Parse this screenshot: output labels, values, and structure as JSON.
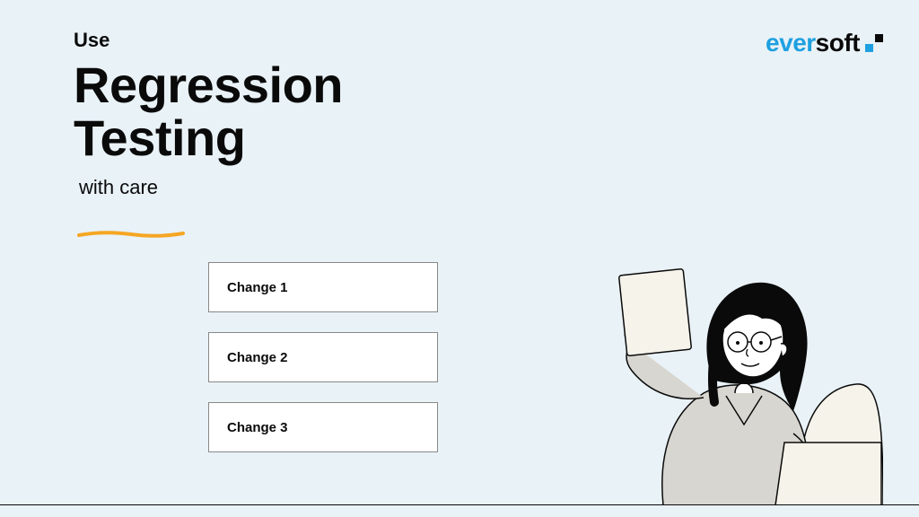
{
  "heading": {
    "pre": "Use",
    "line1": "Regression",
    "line2": "Testing",
    "post": "with care"
  },
  "logo": {
    "part1": "ever",
    "part2": "soft"
  },
  "changes": {
    "items": [
      {
        "label": "Change 1"
      },
      {
        "label": "Change 2"
      },
      {
        "label": "Change 3"
      }
    ]
  },
  "colors": {
    "accent_blue": "#1ea0e0",
    "accent_orange": "#f5a623",
    "bg": "#e9f2f7"
  }
}
